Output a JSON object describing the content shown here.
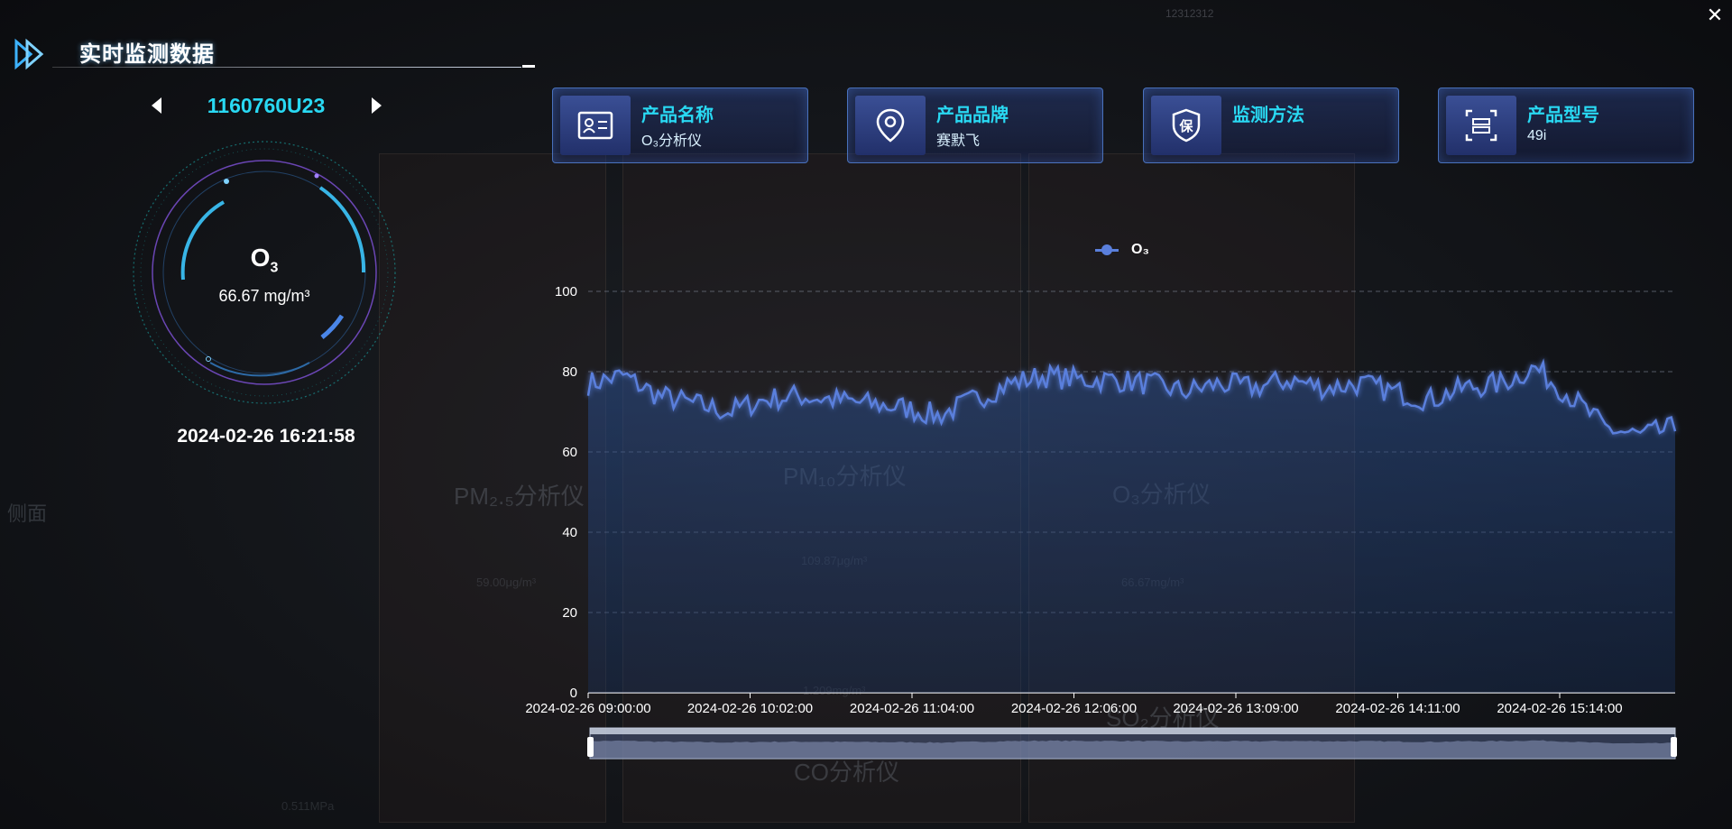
{
  "header": {
    "title": "实时监测数据",
    "window_ref": "12312312"
  },
  "device": {
    "id": "1160760U23"
  },
  "gauge": {
    "name_main": "O",
    "name_sub": "3",
    "value": "66.67 mg/m³"
  },
  "timestamp": "2024-02-26 16:21:58",
  "cards": [
    {
      "label": "产品名称",
      "value": "O₃分析仪",
      "icon": "id-card-icon"
    },
    {
      "label": "产品品牌",
      "value": "赛默飞",
      "icon": "location-pin-icon"
    },
    {
      "label": "监测方法",
      "value": "",
      "icon": "shield-icon"
    },
    {
      "label": "产品型号",
      "value": "49i",
      "icon": "model-frame-icon"
    }
  ],
  "background": {
    "labels": [
      "PM₂.₅分析仪",
      "PM₁₀分析仪",
      "O₃分析仪",
      "SO₂分析仪",
      "CO分析仪",
      "侧面"
    ],
    "readouts": [
      "59.00μg/m³",
      "109.87μg/m³",
      "66.67mg/m³",
      "1.209mg/m³",
      "0.511MPa"
    ]
  },
  "colors": {
    "accent": "#29d9f3",
    "series": "#5a7fdc",
    "card_border": "#5a8ce6"
  },
  "chart_data": {
    "type": "area",
    "series": [
      {
        "name": "O₃"
      }
    ],
    "ylim": [
      0,
      100
    ],
    "yticks": [
      "0",
      "20",
      "40",
      "60",
      "80",
      "100"
    ],
    "xticks": [
      "2024-02-26 09:00:00",
      "2024-02-26 10:02:00",
      "2024-02-26 11:04:00",
      "2024-02-26 12:06:00",
      "2024-02-26 13:09:00",
      "2024-02-26 14:11:00",
      "2024-02-26 15:14:00"
    ],
    "grid": true,
    "legend_position": "top-center",
    "x": [
      "09:00",
      "09:15",
      "09:30",
      "09:45",
      "10:00",
      "10:15",
      "10:30",
      "10:45",
      "11:00",
      "11:15",
      "11:30",
      "11:45",
      "12:00",
      "12:15",
      "12:30",
      "12:45",
      "13:00",
      "13:15",
      "13:30",
      "13:45",
      "14:00",
      "14:15",
      "14:30",
      "14:45",
      "15:00",
      "15:15",
      "15:30",
      "15:45",
      "16:00",
      "16:15",
      "16:21"
    ],
    "values": [
      77,
      79,
      74,
      72,
      70,
      73,
      74,
      73,
      72,
      71,
      69,
      73,
      77,
      79,
      78,
      78,
      77,
      75,
      77,
      76,
      78,
      76,
      77,
      75,
      73,
      76,
      77,
      81,
      74,
      66,
      64,
      66
    ]
  }
}
